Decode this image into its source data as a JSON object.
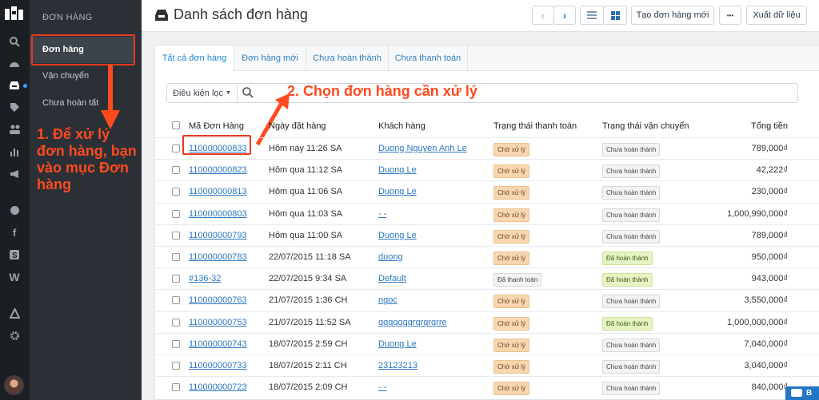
{
  "sidebar": {
    "title": "ĐƠN HÀNG",
    "items": [
      {
        "label": "Đơn hàng"
      },
      {
        "label": "Vận chuyển"
      },
      {
        "label": "Chưa hoàn tất"
      }
    ]
  },
  "annotations": {
    "step1": "1. Để xử lý đơn hàng, bạn vào mục Đơn hàng",
    "step2": "2. Chọn đơn hàng cần xử lý",
    "color": "#ff4a1f"
  },
  "header": {
    "title": "Danh sách đơn hàng",
    "create_label": "Tạo đơn hàng mới",
    "more_label": "•••",
    "export_label": "Xuất dữ liệu"
  },
  "tabs": [
    {
      "label": "Tất cả đơn hàng"
    },
    {
      "label": "Đơn hàng mới"
    },
    {
      "label": "Chưa hoàn thành"
    },
    {
      "label": "Chưa thanh toán"
    }
  ],
  "filter": {
    "label": "Điều kiện lọc"
  },
  "table": {
    "headers": {
      "code": "Mã Đơn Hàng",
      "date": "Ngày đặt hàng",
      "customer": "Khách hàng",
      "payment": "Trạng thái thanh toán",
      "shipping": "Trạng thái vận chuyển",
      "total": "Tổng tiền"
    },
    "rows": [
      {
        "code": "110000000833",
        "date": "Hôm nay 11:26 SA",
        "customer": "Duong Nguyen Anh Le",
        "payment": "Chờ xử lý",
        "pay_kind": "wait",
        "shipping": "Chưa hoàn thành",
        "ship_kind": "pend",
        "total": "789,000₫"
      },
      {
        "code": "110000000823",
        "date": "Hôm qua 11:12 SA",
        "customer": "Duong Le",
        "payment": "Chờ xử lý",
        "pay_kind": "wait",
        "shipping": "Chưa hoàn thành",
        "ship_kind": "pend",
        "total": "42,222₫"
      },
      {
        "code": "110000000813",
        "date": "Hôm qua 11:06 SA",
        "customer": "Duong Le",
        "payment": "Chờ xử lý",
        "pay_kind": "wait",
        "shipping": "Chưa hoàn thành",
        "ship_kind": "pend",
        "total": "230,000₫"
      },
      {
        "code": "110000000803",
        "date": "Hôm qua 11:03 SA",
        "customer": "- -",
        "payment": "Chờ xử lý",
        "pay_kind": "wait",
        "shipping": "Chưa hoàn thành",
        "ship_kind": "pend",
        "total": "1,000,990,000₫"
      },
      {
        "code": "110000000793",
        "date": "Hôm qua 11:00 SA",
        "customer": "Duong Le",
        "payment": "Chờ xử lý",
        "pay_kind": "wait",
        "shipping": "Chưa hoàn thành",
        "ship_kind": "pend",
        "total": "789,000₫"
      },
      {
        "code": "110000000783",
        "date": "22/07/2015 11:18 SA",
        "customer": "duong",
        "payment": "Chờ xử lý",
        "pay_kind": "wait",
        "shipping": "Đã hoàn thành",
        "ship_kind": "done",
        "total": "950,000₫"
      },
      {
        "code": "#136-32",
        "date": "22/07/2015 9:34 SA",
        "customer": "Default",
        "payment": "Đã thanh toán",
        "pay_kind": "pend",
        "shipping": "Đã hoàn thành",
        "ship_kind": "done",
        "total": "943,000₫"
      },
      {
        "code": "110000000763",
        "date": "21/07/2015 1:36 CH",
        "customer": "ngoc",
        "payment": "Chờ xử lý",
        "pay_kind": "wait",
        "shipping": "Chưa hoàn thành",
        "ship_kind": "pend",
        "total": "3,550,000₫"
      },
      {
        "code": "110000000753",
        "date": "21/07/2015 11:52 SA",
        "customer": "qqqqqqqrqrqrqrre",
        "payment": "Chờ xử lý",
        "pay_kind": "wait",
        "shipping": "Đã hoàn thành",
        "ship_kind": "done",
        "total": "1,000,000,000₫"
      },
      {
        "code": "110000000743",
        "date": "18/07/2015 2:59 CH",
        "customer": "Duong Le",
        "payment": "Chờ xử lý",
        "pay_kind": "wait",
        "shipping": "Chưa hoàn thành",
        "ship_kind": "pend",
        "total": "7,040,000₫"
      },
      {
        "code": "110000000733",
        "date": "18/07/2015 2:11 CH",
        "customer": "23123213",
        "payment": "Chờ xử lý",
        "pay_kind": "wait",
        "shipping": "Chưa hoàn thành",
        "ship_kind": "pend",
        "total": "3,040,000₫"
      },
      {
        "code": "110000000723",
        "date": "18/07/2015 2:09 CH",
        "customer": "- -",
        "payment": "Chờ xử lý",
        "pay_kind": "wait",
        "shipping": "Chưa hoàn thành",
        "ship_kind": "pend",
        "total": "840,000₫"
      }
    ]
  },
  "chat": {
    "label": "B"
  }
}
